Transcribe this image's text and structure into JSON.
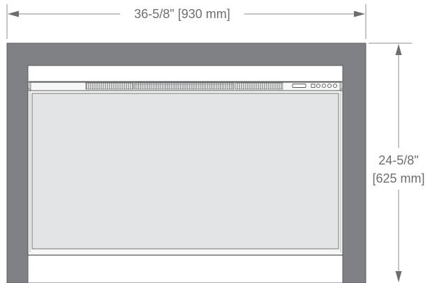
{
  "dimensions": {
    "width_label": "36-5/8\" [930 mm]",
    "height_label_line1": "24-5/8\"",
    "height_label_line2": "[625 mm]"
  },
  "colors": {
    "surround": "#808184",
    "surround_edge": "#5b5c5e",
    "glass": "#e3e4e5",
    "frame": "#f7f7f7",
    "line": "#57585a",
    "dimension_line": "#8a8b8d",
    "dimension_text": "#6d6e70"
  }
}
